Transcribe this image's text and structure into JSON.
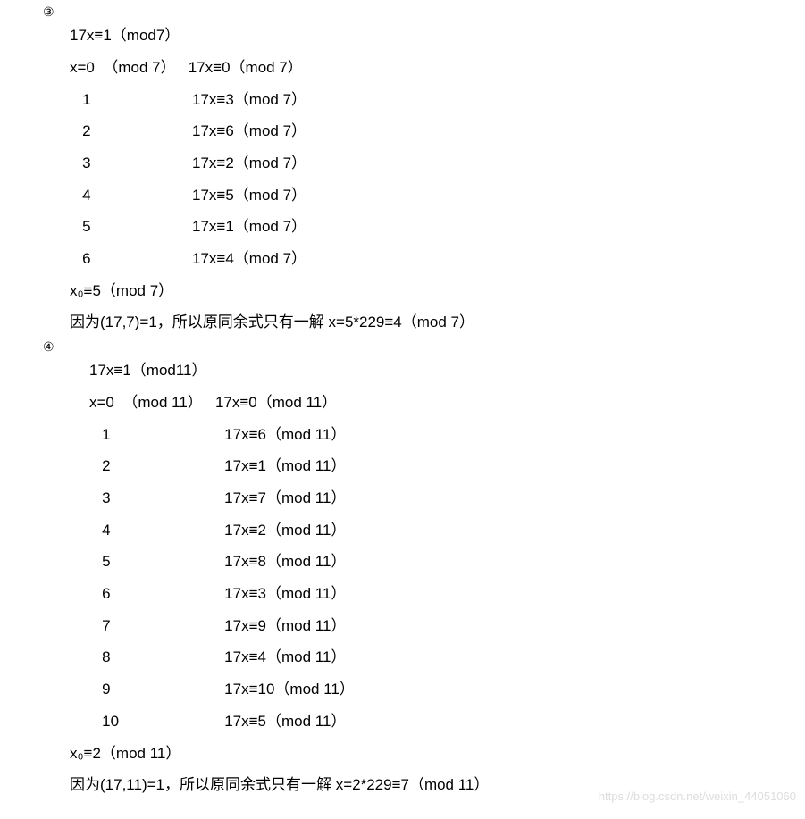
{
  "section1": {
    "num": "③",
    "heading": "17x≡1（mod7）",
    "rowHeader": {
      "left": "x=0  （mod 7）",
      "right": "17x≡0（mod 7）"
    },
    "rows": [
      {
        "x": "1",
        "res": "17x≡3（mod 7）"
      },
      {
        "x": "2",
        "res": "17x≡6（mod 7）"
      },
      {
        "x": "3",
        "res": "17x≡2（mod 7）"
      },
      {
        "x": "4",
        "res": "17x≡5（mod 7）"
      },
      {
        "x": "5",
        "res": "17x≡1（mod 7）"
      },
      {
        "x": "6",
        "res": "17x≡4（mod 7）"
      }
    ],
    "x0": "x₀≡5（mod 7）",
    "conclusion": "因为(17,7)=1，所以原同余式只有一解 x=5*229≡4（mod 7）"
  },
  "section2": {
    "num": "④",
    "heading": "17x≡1（mod11）",
    "rowHeader": {
      "left": "x=0  （mod 11）",
      "right": "17x≡0（mod 11）"
    },
    "rows": [
      {
        "x": "1",
        "res": "17x≡6（mod 11）"
      },
      {
        "x": "2",
        "res": "17x≡1（mod 11）"
      },
      {
        "x": "3",
        "res": "17x≡7（mod 11）"
      },
      {
        "x": "4",
        "res": "17x≡2（mod 11）"
      },
      {
        "x": "5",
        "res": "17x≡8（mod 11）"
      },
      {
        "x": "6",
        "res": "17x≡3（mod 11）"
      },
      {
        "x": "7",
        "res": "17x≡9（mod 11）"
      },
      {
        "x": "8",
        "res": "17x≡4（mod 11）"
      },
      {
        "x": "9",
        "res": "17x≡10（mod 11）"
      },
      {
        "x": "10",
        "res": "17x≡5（mod 11）"
      }
    ],
    "x0": "x₀≡2（mod 11）",
    "conclusion": "因为(17,11)=1，所以原同余式只有一解 x=2*229≡7（mod 11）"
  },
  "watermark": "https://blog.csdn.net/weixin_44051060"
}
